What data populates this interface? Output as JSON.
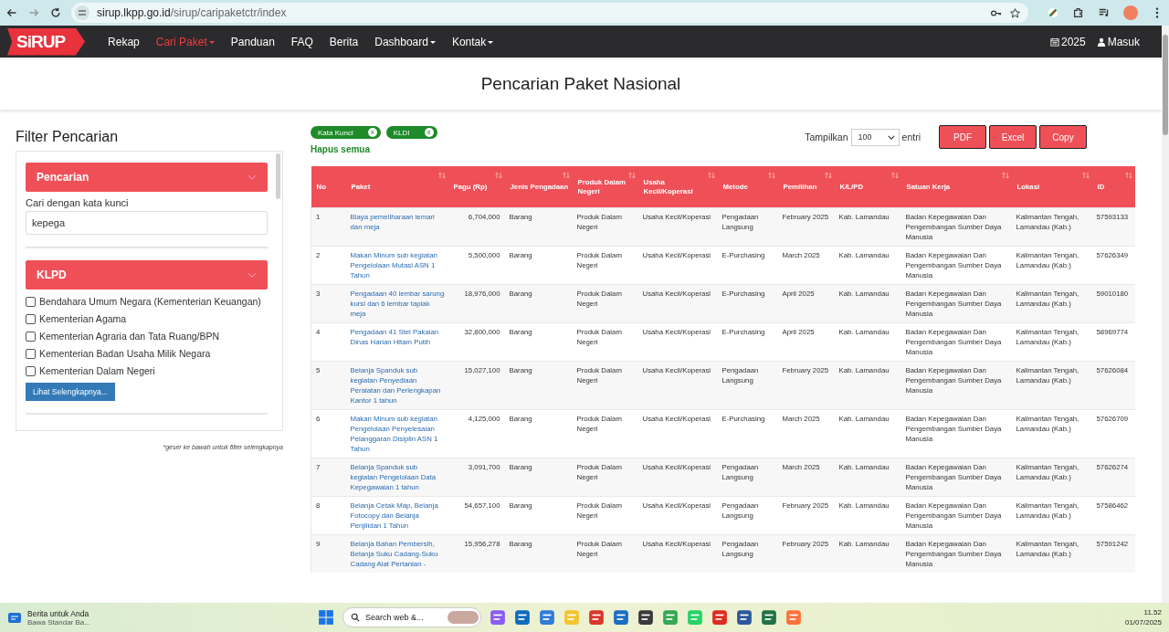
{
  "browser": {
    "url_host": "sirup.lkpp.go.id",
    "url_path": "/sirup/caripaketctr/index"
  },
  "navbar": {
    "logo": "SiRUP",
    "items": [
      {
        "label": "Rekap",
        "selected": false,
        "dropdown": false
      },
      {
        "label": "Cari Paket",
        "selected": true,
        "dropdown": true
      },
      {
        "label": "Panduan",
        "selected": false,
        "dropdown": false
      },
      {
        "label": "FAQ",
        "selected": false,
        "dropdown": false
      },
      {
        "label": "Berita",
        "selected": false,
        "dropdown": false
      },
      {
        "label": "Dashboard",
        "selected": false,
        "dropdown": true
      },
      {
        "label": "Kontak",
        "selected": false,
        "dropdown": true
      }
    ],
    "year": "2025",
    "login": "Masuk"
  },
  "page_title": "Pencarian Paket Nasional",
  "filter": {
    "title": "Filter Pencarian",
    "search_section": {
      "title": "Pencarian",
      "label": "Cari dengan kata kunci",
      "value": "kepega"
    },
    "klpd_section": {
      "title": "KLPD",
      "options": [
        {
          "label": "Bendahara Umum Negara (Kementerian Keuangan)",
          "checked": false
        },
        {
          "label": "Kementerian Agama",
          "checked": false
        },
        {
          "label": "Kementerian Agraria dan Tata Ruang/BPN",
          "checked": false
        },
        {
          "label": "Kementerian Badan Usaha Milik Negara",
          "checked": false
        },
        {
          "label": "Kementerian Dalam Negeri",
          "checked": false
        }
      ],
      "more_button": "Lihat Selengkapnya..."
    },
    "note": "*geser ke bawah untuk filter selengkapnya"
  },
  "active_filters": [
    {
      "label": "Kata Kunci",
      "remove": "x"
    },
    {
      "label": "KLDI",
      "remove": "x"
    }
  ],
  "clear_all": "Hapus semua",
  "page_length": {
    "label": "Tampilkan",
    "value": "100",
    "suffix": "entri"
  },
  "export_buttons": [
    "PDF",
    "Excel",
    "Copy"
  ],
  "table": {
    "columns": [
      "No",
      "Paket",
      "Pagu (Rp)",
      "Jenis Pengadaan",
      "Produk Dalam Negeri",
      "Usaha Kecil/Koperasi",
      "Metode",
      "Pemilihan",
      "K/L/PD",
      "Satuan Kerja",
      "Lokasi",
      "ID"
    ],
    "rows": [
      [
        "1",
        "Biaya pemeliharaan lemari dan meja",
        "6,704,000",
        "Barang",
        "Produk Dalam Negeri",
        "Usaha Kecil/Koperasi",
        "Pengadaan Langsung",
        "February 2025",
        "Kab. Lamandau",
        "Badan Kepegawaian Dan Pengembangan Sumber Daya Manusia",
        "Kalimantan Tengah, Lamandau (Kab.)",
        "57593133"
      ],
      [
        "2",
        "Makan Minum sub kegiatan Pengelolaan Mutasi ASN 1 Tahun",
        "5,500,000",
        "Barang",
        "Produk Dalam Negeri",
        "Usaha Kecil/Koperasi",
        "E-Purchasing",
        "March 2025",
        "Kab. Lamandau",
        "Badan Kepegawaian Dan Pengembangan Sumber Daya Manusia",
        "Kalimantan Tengah, Lamandau (Kab.)",
        "57626349"
      ],
      [
        "3",
        "Pengadaan 40 lembar sarung kursi dan 6 lembar taplak meja",
        "18,976,000",
        "Barang",
        "Produk Dalam Negeri",
        "Usaha Kecil/Koperasi",
        "E-Purchasing",
        "April 2025",
        "Kab. Lamandau",
        "Badan Kepegawaian Dan Pengembangan Sumber Daya Manusia",
        "Kalimantan Tengah, Lamandau (Kab.)",
        "59010180"
      ],
      [
        "4",
        "Pengadaan 41 Stel Pakaian Dinas Harian Hitam Putih",
        "32,800,000",
        "Barang",
        "Produk Dalam Negeri",
        "Usaha Kecil/Koperasi",
        "E-Purchasing",
        "April 2025",
        "Kab. Lamandau",
        "Badan Kepegawaian Dan Pengembangan Sumber Daya Manusia",
        "Kalimantan Tengah, Lamandau (Kab.)",
        "58969774"
      ],
      [
        "5",
        "Belanja Spanduk sub kegiatan Penyediaan Peralatan dan Perlengkapan Kantor 1 tahun",
        "15,027,100",
        "Barang",
        "Produk Dalam Negeri",
        "Usaha Kecil/Koperasi",
        "Pengadaan Langsung",
        "February 2025",
        "Kab. Lamandau",
        "Badan Kepegawaian Dan Pengembangan Sumber Daya Manusia",
        "Kalimantan Tengah, Lamandau (Kab.)",
        "57626084"
      ],
      [
        "6",
        "Makan Minum sub kegiatan Pengelolaan Penyelesaian Pelanggaran Disiplin ASN 1 Tahun",
        "4,125,000",
        "Barang",
        "Produk Dalam Negeri",
        "Usaha Kecil/Koperasi",
        "E-Purchasing",
        "March 2025",
        "Kab. Lamandau",
        "Badan Kepegawaian Dan Pengembangan Sumber Daya Manusia",
        "Kalimantan Tengah, Lamandau (Kab.)",
        "57626709"
      ],
      [
        "7",
        "Belanja Spanduk sub kegiatan Pengelolaan Data Kepegawaian 1 tahun",
        "3,091,700",
        "Barang",
        "Produk Dalam Negeri",
        "Usaha Kecil/Koperasi",
        "Pengadaan Langsung",
        "March 2025",
        "Kab. Lamandau",
        "Badan Kepegawaian Dan Pengembangan Sumber Daya Manusia",
        "Kalimantan Tengah, Lamandau (Kab.)",
        "57626274"
      ],
      [
        "8",
        "Belanja Cetak Map, Belanja Fotocopy dan Belanja Penjilidan 1 Tahun",
        "54,657,100",
        "Barang",
        "Produk Dalam Negeri",
        "Usaha Kecil/Koperasi",
        "Pengadaan Langsung",
        "February 2025",
        "Kab. Lamandau",
        "Badan Kepegawaian Dan Pengembangan Sumber Daya Manusia",
        "Kalimantan Tengah, Lamandau (Kab.)",
        "57586462"
      ],
      [
        "9",
        "Belanja Bahan Pembersih, Belanja Suku Cadang-Suku Cadang Alat Pertanian -",
        "15,956,278",
        "Barang",
        "Produk Dalam Negeri",
        "Usaha Kecil/Koperasi",
        "Pengadaan Langsung",
        "February 2025",
        "Kab. Lamandau",
        "Badan Kepegawaian Dan Pengembangan Sumber Daya Manusia",
        "Kalimantan Tengah, Lamandau (Kab.)",
        "57591242"
      ]
    ]
  },
  "taskbar": {
    "news_title": "Berita untuk Anda",
    "news_text": "Bawa Standar Ba...",
    "search_placeholder": "Search web &...",
    "time": "11.52",
    "date": "01/07/2025"
  }
}
